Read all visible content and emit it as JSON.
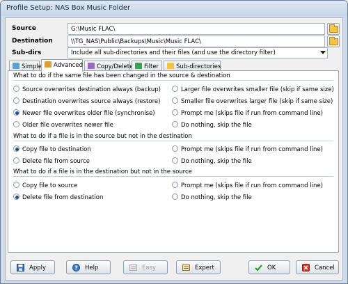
{
  "window": {
    "title": "Profile Setup: NAS Box Music Folder"
  },
  "source": {
    "label": "Source",
    "value": "G:\\Music FLAC\\"
  },
  "destination": {
    "label": "Destination",
    "value": "\\\\TG_NAS\\Public\\Backups\\Music\\Music FLAC\\"
  },
  "subdirs": {
    "label": "Sub-dirs",
    "value": "Include all sub-directories and their files (and use the directory filter)"
  },
  "tabs": [
    {
      "label": "Simple",
      "icon": "simple-icon"
    },
    {
      "label": "Advanced",
      "icon": "advanced-icon"
    },
    {
      "label": "Copy/Delete",
      "icon": "copy-delete-icon"
    },
    {
      "label": "Filter",
      "icon": "filter-icon"
    },
    {
      "label": "Sub-directories",
      "icon": "sub-directories-icon"
    }
  ],
  "groups": [
    {
      "heading": "What to do if the same file has been changed in the source & destination",
      "left": [
        {
          "label": "Source overwrites destination always (backup)",
          "selected": false
        },
        {
          "label": "Destination overwrites source always (restore)",
          "selected": false
        },
        {
          "label": "Newer file overwrites older file (synchronise)",
          "selected": true
        },
        {
          "label": "Older file overwrites newer file",
          "selected": false
        }
      ],
      "right": [
        {
          "label": "Larger file overwrites smaller file (skip if same size)",
          "selected": false
        },
        {
          "label": "Smaller file overwrites larger file (skip if same size)",
          "selected": false
        },
        {
          "label": "Prompt me (skips file if run from command line)",
          "selected": false
        },
        {
          "label": "Do nothing, skip the file",
          "selected": false
        }
      ]
    },
    {
      "heading": "What to do if a file is in the source but not in the destination",
      "left": [
        {
          "label": "Copy file to destination",
          "selected": true
        },
        {
          "label": "Delete file from source",
          "selected": false
        }
      ],
      "right": [
        {
          "label": "Prompt me  (skips file if run from command line)",
          "selected": false
        },
        {
          "label": "Do nothing, skip the file",
          "selected": false
        }
      ]
    },
    {
      "heading": "What to do if a file is in the destination but not in the source",
      "left": [
        {
          "label": "Copy file to source",
          "selected": false
        },
        {
          "label": "Delete file from destination",
          "selected": true
        }
      ],
      "right": [
        {
          "label": "Prompt me  (skips file if run from command line)",
          "selected": false
        },
        {
          "label": "Do nothing, skip the file",
          "selected": false
        }
      ]
    }
  ],
  "buttons": {
    "apply": "Apply",
    "help": "Help",
    "easy": "Easy",
    "expert": "Expert",
    "ok": "OK",
    "cancel": "Cancel"
  },
  "colors": {
    "accent": "#1f4e8c",
    "ok": "#2e9b2e",
    "cancel": "#d23a2a",
    "folder": "#f4c34a"
  }
}
